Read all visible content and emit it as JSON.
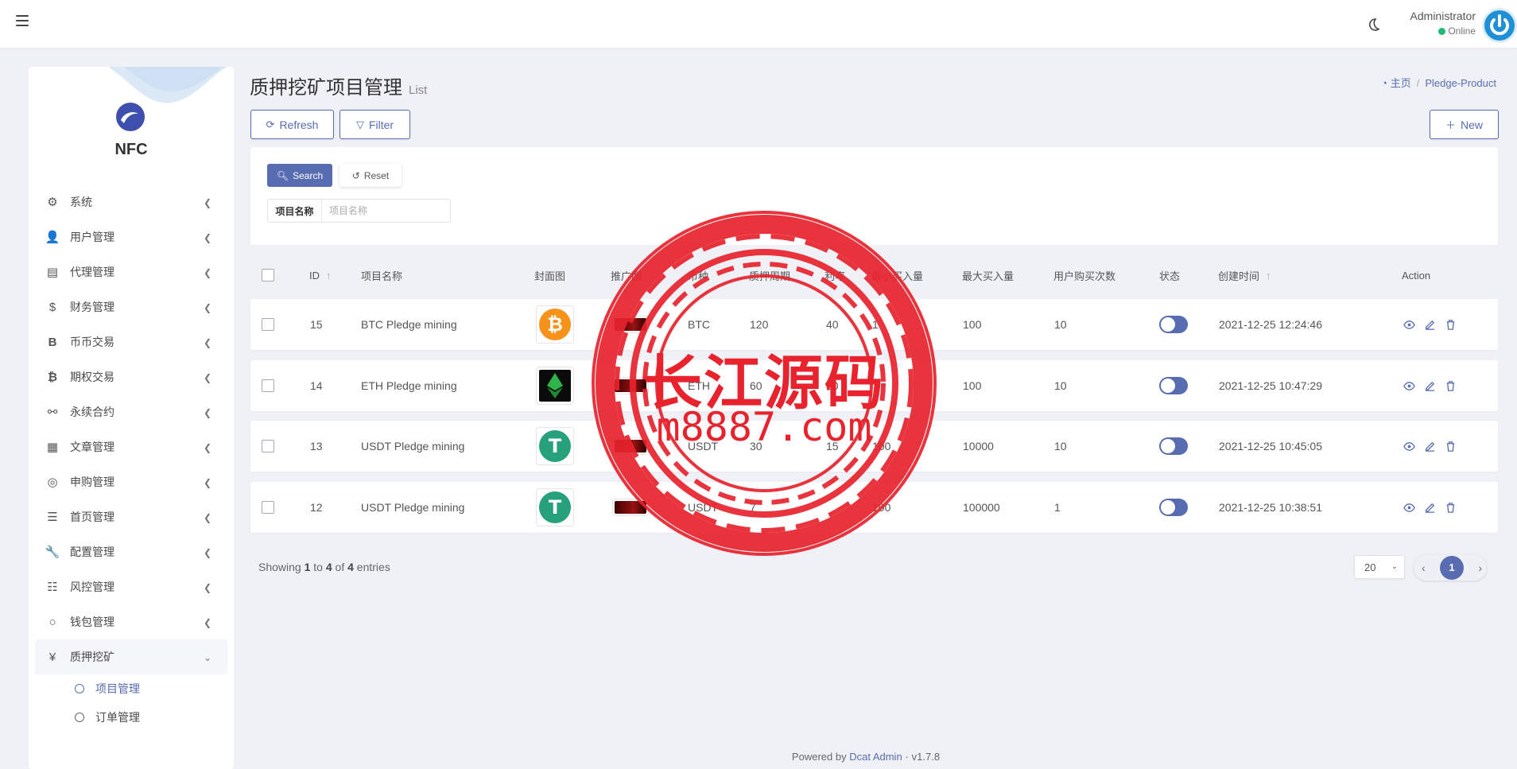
{
  "topbar": {
    "user_name": "Administrator",
    "user_status": "Online"
  },
  "sidebar": {
    "brand": "NFC",
    "items": [
      {
        "label": "系统",
        "icon": "gear-icon"
      },
      {
        "label": "用户管理",
        "icon": "users-icon"
      },
      {
        "label": "代理管理",
        "icon": "id-card-icon"
      },
      {
        "label": "财务管理",
        "icon": "dollar-icon"
      },
      {
        "label": "币币交易",
        "icon": "bold-b-icon"
      },
      {
        "label": "期权交易",
        "icon": "bitcoin-icon"
      },
      {
        "label": "永续合约",
        "icon": "link-icon"
      },
      {
        "label": "文章管理",
        "icon": "newspaper-icon"
      },
      {
        "label": "申购管理",
        "icon": "lifebuoy-icon"
      },
      {
        "label": "首页管理",
        "icon": "bars-icon"
      },
      {
        "label": "配置管理",
        "icon": "wrench-icon"
      },
      {
        "label": "风控管理",
        "icon": "list-icon"
      },
      {
        "label": "钱包管理",
        "icon": "circle-icon"
      },
      {
        "label": "质押挖矿",
        "icon": "yen-icon"
      }
    ],
    "subitems": [
      {
        "label": "项目管理"
      },
      {
        "label": "订单管理"
      }
    ]
  },
  "header": {
    "title": "质押挖矿项目管理",
    "subtitle": "List",
    "breadcrumb_home": "主页",
    "breadcrumb_current": "Pledge-Product"
  },
  "toolbar": {
    "refresh_label": "Refresh",
    "filter_label": "Filter",
    "new_label": "New"
  },
  "filter": {
    "search_label": "Search",
    "reset_label": "Reset",
    "field_label": "项目名称",
    "field_placeholder": "项目名称",
    "field_value": ""
  },
  "table": {
    "columns": [
      "ID",
      "项目名称",
      "封面图",
      "推广图",
      "币种",
      "质押周期",
      "利率",
      "最小买入量",
      "最大买入量",
      "用户购买次数",
      "状态",
      "创建时间",
      "Action"
    ],
    "rows": [
      {
        "id": "15",
        "name": "BTC Pledge mining",
        "coin": "bitcoin",
        "currency": "BTC",
        "period": "120",
        "rate": "40",
        "min": "1",
        "max": "100",
        "times": "10",
        "status": "on",
        "created": "2021-12-25 12:24:46"
      },
      {
        "id": "14",
        "name": "ETH Pledge mining",
        "coin": "ethereum",
        "currency": "ETH",
        "period": "60",
        "rate": "20",
        "min": "",
        "max": "100",
        "times": "10",
        "status": "on",
        "created": "2021-12-25 10:47:29"
      },
      {
        "id": "13",
        "name": "USDT Pledge mining",
        "coin": "tether",
        "currency": "USDT",
        "period": "30",
        "rate": "15",
        "min": "100",
        "max": "10000",
        "times": "10",
        "status": "on",
        "created": "2021-12-25 10:45:05"
      },
      {
        "id": "12",
        "name": "USDT Pledge mining",
        "coin": "tether",
        "currency": "USDT",
        "period": "7",
        "rate": "",
        "min": "100",
        "max": "100000",
        "times": "1",
        "status": "on",
        "created": "2021-12-25 10:38:51"
      }
    ]
  },
  "pagination": {
    "showing_prefix": "Showing ",
    "from": "1",
    "to_word": " to ",
    "to": "4",
    "of_word": " of ",
    "total": "4",
    "suffix": " entries",
    "per_page": "20",
    "current_page": "1"
  },
  "footer": {
    "powered": "Powered by",
    "link": "Dcat Admin",
    "sep": "·",
    "version": "v1.7.8"
  },
  "watermark": {
    "line1": "长江源码",
    "line2": "m8887.com"
  },
  "colors": {
    "accent": "#586cb1",
    "online": "#21b978",
    "watermark": "#e8232e",
    "background": "#eff1f7"
  }
}
